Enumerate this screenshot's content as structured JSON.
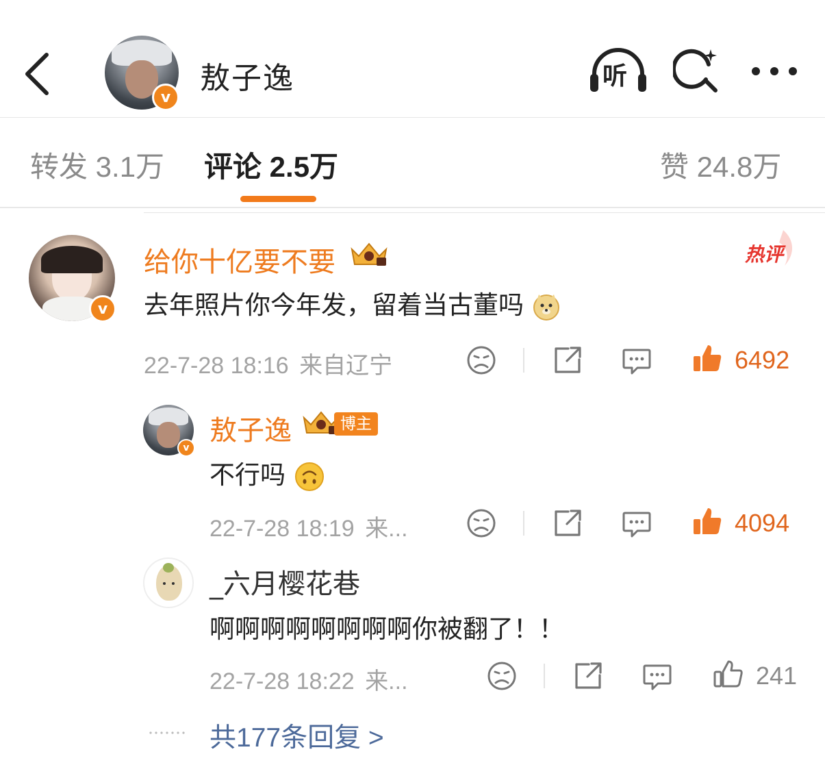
{
  "header": {
    "author_name": "敖子逸",
    "listen_label": "听",
    "icons": {
      "back": "back-arrow-icon",
      "listen": "headphones-icon",
      "search": "search-sparkle-icon",
      "more": "more-dots-icon"
    }
  },
  "tabs": [
    {
      "label": "转发 3.1万",
      "active": false
    },
    {
      "label": "评论 2.5万",
      "active": true
    },
    {
      "label": "赞 24.8万",
      "active": false
    }
  ],
  "colors": {
    "accent": "#f27a1a",
    "name_orange": "#ee7b1f",
    "like_orange": "#e0651c",
    "link_blue": "#4d6a9a",
    "hot_red": "#e6362f"
  },
  "comment": {
    "user": "给你十亿要不要",
    "text": "去年照片你今年发，留着当古董吗",
    "emoji": "doge",
    "time": "22-7-28 18:16",
    "location": "来自辽宁",
    "likes": "6492",
    "hot_label": "热评",
    "liked": true
  },
  "replies": [
    {
      "user": "敖子逸",
      "badge": "博主",
      "text": "不行吗",
      "emoji": "upside-down-face",
      "time": "22-7-28 18:19",
      "location": "来...",
      "likes": "4094",
      "liked": true
    },
    {
      "user": "_六月樱花巷",
      "text": "啊啊啊啊啊啊啊啊你被翻了！！",
      "time": "22-7-28 18:22",
      "location": "来...",
      "likes": "241",
      "liked": false
    }
  ],
  "more_replies": "共177条回复 >"
}
